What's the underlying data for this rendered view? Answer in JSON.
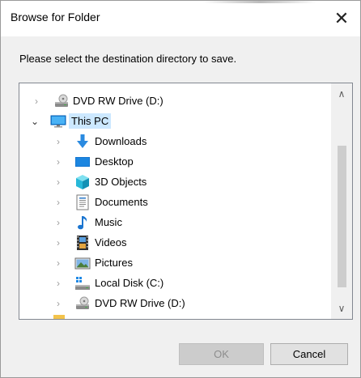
{
  "window": {
    "title": "Browse for Folder",
    "close_glyph": "✕"
  },
  "instruction": "Please select the destination directory to save.",
  "tree": {
    "items": [
      {
        "label": "DVD RW Drive (D:)",
        "icon": "dvd-drive-icon",
        "expander": "collapsed",
        "selected": false
      },
      {
        "label": "This PC",
        "icon": "this-pc-icon",
        "expander": "expanded",
        "selected": true
      },
      {
        "label": "Downloads",
        "icon": "downloads-icon",
        "expander": "collapsed",
        "selected": false
      },
      {
        "label": "Desktop",
        "icon": "desktop-icon",
        "expander": "collapsed",
        "selected": false
      },
      {
        "label": "3D Objects",
        "icon": "3d-objects-icon",
        "expander": "collapsed",
        "selected": false
      },
      {
        "label": "Documents",
        "icon": "documents-icon",
        "expander": "collapsed",
        "selected": false
      },
      {
        "label": "Music",
        "icon": "music-icon",
        "expander": "collapsed",
        "selected": false
      },
      {
        "label": "Videos",
        "icon": "videos-icon",
        "expander": "collapsed",
        "selected": false
      },
      {
        "label": "Pictures",
        "icon": "pictures-icon",
        "expander": "collapsed",
        "selected": false
      },
      {
        "label": "Local Disk (C:)",
        "icon": "local-disk-icon",
        "expander": "collapsed",
        "selected": false
      },
      {
        "label": "DVD RW Drive (D:)",
        "icon": "dvd-drive-icon",
        "expander": "collapsed",
        "selected": false
      }
    ],
    "scroll_up_glyph": "∧",
    "scroll_down_glyph": "∨"
  },
  "buttons": {
    "ok": "OK",
    "cancel": "Cancel",
    "ok_enabled": false
  },
  "colors": {
    "selection": "#cce8ff",
    "accent_blue": "#0078d7"
  }
}
